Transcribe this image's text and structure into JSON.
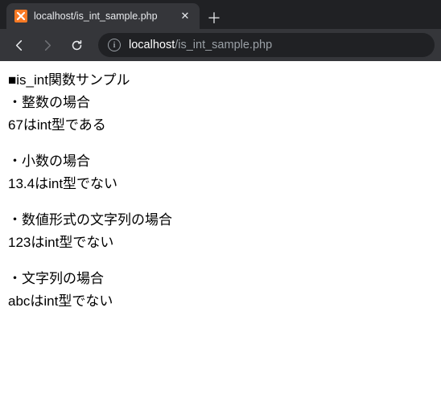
{
  "browser": {
    "tab_title": "localhost/is_int_sample.php",
    "url_host": "localhost",
    "url_path": "/is_int_sample.php"
  },
  "page": {
    "heading": "■is_int関数サンプル",
    "sections": [
      {
        "label": "・整数の場合",
        "result": "67はint型である"
      },
      {
        "label": "・小数の場合",
        "result": "13.4はint型でない"
      },
      {
        "label": "・数値形式の文字列の場合",
        "result": "123はint型でない"
      },
      {
        "label": "・文字列の場合",
        "result": "abcはint型でない"
      }
    ]
  }
}
